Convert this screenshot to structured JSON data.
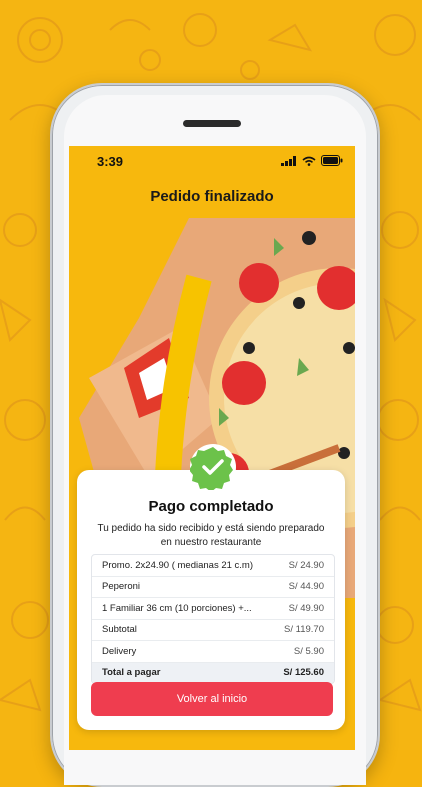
{
  "status_bar": {
    "time": "3:39"
  },
  "nav": {
    "title": "Pedido finalizado"
  },
  "card": {
    "title": "Pago completado",
    "subtitle": "Tu pedido ha sido recibido y está siendo preparado en nuestro restaurante"
  },
  "order": {
    "items": [
      {
        "label": "Promo. 2x24.90 ( medianas 21 c.m)",
        "value": "S/ 24.90"
      },
      {
        "label": "Peperoni",
        "value": "S/ 44.90"
      },
      {
        "label": "1 Familiar 36 cm (10 porciones) +...",
        "value": "S/ 49.90"
      },
      {
        "label": "Subtotal",
        "value": "S/ 119.70"
      },
      {
        "label": "Delivery",
        "value": "S/ 5.90"
      },
      {
        "label": "Total a pagar",
        "value": "S/ 125.60"
      }
    ]
  },
  "actions": {
    "back_home": "Volver al inicio"
  },
  "colors": {
    "accent": "#ef3d4f",
    "background": "#f5b512",
    "success": "#6cc24a"
  }
}
